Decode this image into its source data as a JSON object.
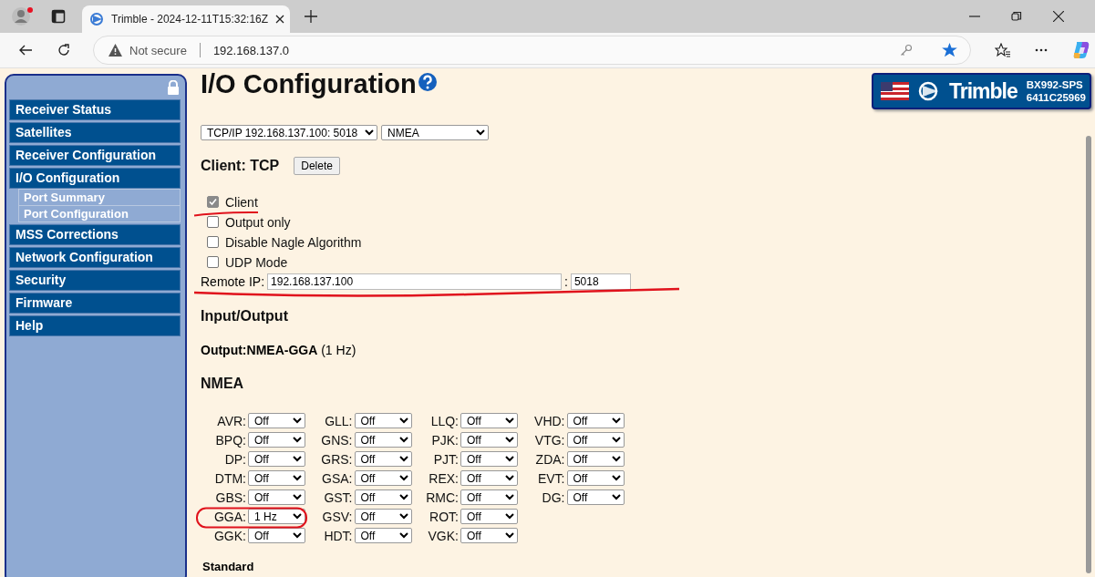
{
  "browser": {
    "tab_title": "Trimble - 2024-12-11T15:32:16Z",
    "security": "Not secure",
    "url": "192.168.137.0"
  },
  "sidebar": {
    "items": [
      {
        "label": "Receiver Status"
      },
      {
        "label": "Satellites"
      },
      {
        "label": "Receiver Configuration"
      },
      {
        "label": "I/O Configuration",
        "children": [
          {
            "label": "Port Summary"
          },
          {
            "label": "Port Configuration"
          }
        ]
      },
      {
        "label": "MSS Corrections"
      },
      {
        "label": "Network Configuration"
      },
      {
        "label": "Security"
      },
      {
        "label": "Firmware"
      },
      {
        "label": "Help"
      }
    ]
  },
  "page": {
    "title": "I/O Configuration"
  },
  "logo": {
    "brand": "Trimble",
    "model": "BX992-SPS",
    "serial": "6411C25969"
  },
  "port_select": "TCP/IP 192.168.137.100: 5018",
  "format_select": "NMEA",
  "client": {
    "heading": "Client: TCP",
    "delete_button": "Delete",
    "options": [
      {
        "label": "Client",
        "checked": true
      },
      {
        "label": "Output only",
        "checked": false
      },
      {
        "label": "Disable Nagle Algorithm",
        "checked": false
      },
      {
        "label": "UDP Mode",
        "checked": false
      }
    ],
    "remote_ip_label": "Remote IP:",
    "remote_ip": "192.168.137.100",
    "separator": ":",
    "port": "5018"
  },
  "input_output": {
    "heading": "Input/Output",
    "output": "**Output:NMEA-GGA** (1 Hz)"
  },
  "nmea": {
    "heading": "NMEA",
    "rows": [
      [
        {
          "label": "AVR:",
          "value": "Off"
        },
        {
          "label": "GLL:",
          "value": "Off"
        },
        {
          "label": "LLQ:",
          "value": "Off"
        },
        {
          "label": "VHD:",
          "value": "Off"
        }
      ],
      [
        {
          "label": "BPQ:",
          "value": "Off"
        },
        {
          "label": "GNS:",
          "value": "Off"
        },
        {
          "label": "PJK:",
          "value": "Off"
        },
        {
          "label": "VTG:",
          "value": "Off"
        }
      ],
      [
        {
          "label": "DP:",
          "value": "Off"
        },
        {
          "label": "GRS:",
          "value": "Off"
        },
        {
          "label": "PJT:",
          "value": "Off"
        },
        {
          "label": "ZDA:",
          "value": "Off"
        }
      ],
      [
        {
          "label": "DTM:",
          "value": "Off"
        },
        {
          "label": "GSA:",
          "value": "Off"
        },
        {
          "label": "REX:",
          "value": "Off"
        },
        {
          "label": "EVT:",
          "value": "Off"
        }
      ],
      [
        {
          "label": "GBS:",
          "value": "Off"
        },
        {
          "label": "GST:",
          "value": "Off"
        },
        {
          "label": "RMC:",
          "value": "Off"
        },
        {
          "label": "DG:",
          "value": "Off"
        }
      ],
      [
        {
          "label": "GGA:",
          "value": "1 Hz"
        },
        {
          "label": "GSV:",
          "value": "Off"
        },
        {
          "label": "ROT:",
          "value": "Off"
        }
      ],
      [
        {
          "label": "GGK:",
          "value": "Off"
        },
        {
          "label": "HDT:",
          "value": "Off"
        },
        {
          "label": "VGK:",
          "value": "Off"
        }
      ]
    ]
  },
  "standard": {
    "heading": "Standard"
  }
}
